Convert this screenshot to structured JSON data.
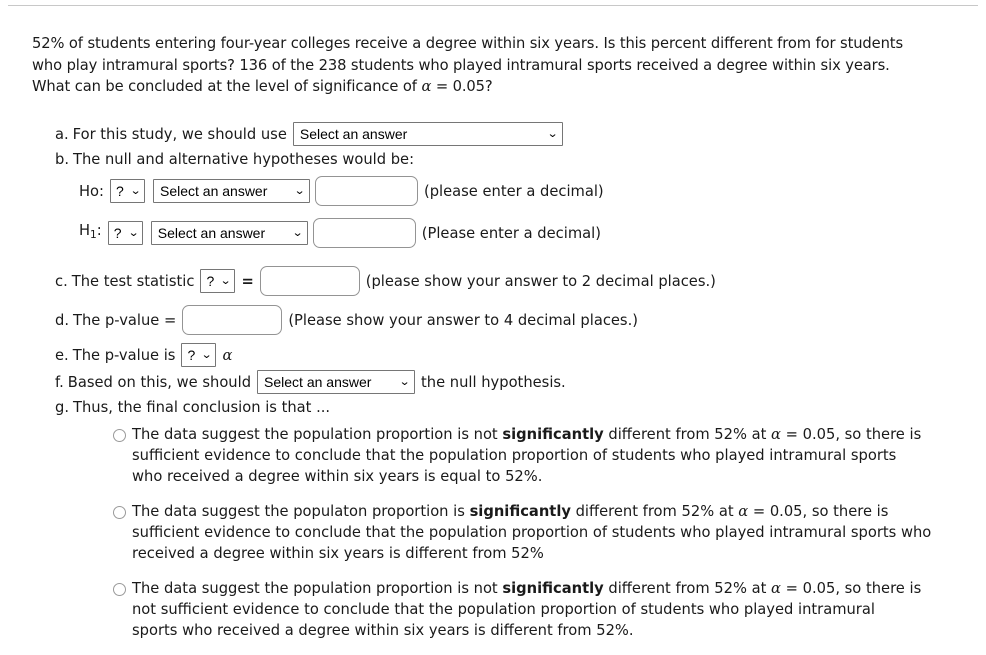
{
  "prompt": {
    "line1": "52% of students entering four-year colleges receive a degree within six years. Is this percent different from",
    "line2": "for students who play intramural sports? 136 of the 238 students who played intramural sports received a",
    "line3_pre": "degree within six years. What can be concluded at the level of significance of ",
    "line3_alpha": "α",
    "line3_post": " = 0.05?"
  },
  "parts": {
    "a": {
      "marker": "a.",
      "label": "For this study, we should use",
      "select_value": "Select an answer"
    },
    "b": {
      "marker": "b.",
      "label": "The null and alternative hypotheses would be:",
      "null_row": {
        "name": "Ho:",
        "symbol_select": "?",
        "relation_select": "Select an answer",
        "value": "",
        "hint": "(please enter a decimal)"
      },
      "alt_row": {
        "name_base": "H",
        "name_sub": "1",
        "name_colon": ":",
        "symbol_select": "?",
        "relation_select": "Select an answer",
        "value": "",
        "hint": "(Please enter a decimal)"
      }
    },
    "c": {
      "marker": "c.",
      "label": "The test statistic",
      "symbol_select": "?",
      "equals": "=",
      "value": "",
      "hint": "(please show your answer to 2 decimal places.)"
    },
    "d": {
      "marker": "d.",
      "label": "The p-value =",
      "value": "",
      "hint": "(Please show your answer to 4 decimal places.)"
    },
    "e": {
      "marker": "e.",
      "label": "The p-value is",
      "comparison_select": "?",
      "alpha": "α"
    },
    "f": {
      "marker": "f.",
      "label_pre": "Based on this, we should",
      "select_value": "Select an answer",
      "label_post": "the null hypothesis."
    },
    "g": {
      "marker": "g.",
      "label": "Thus, the final conclusion is that ..."
    }
  },
  "choices": [
    {
      "id": "choice-1",
      "seg1": "The data suggest the population proportion is not ",
      "bold1": "significantly",
      "seg2": " different from 52% at ",
      "alpha": "α",
      "seg3": " = 0.05, so there is sufficient evidence to conclude that the population proportion of students who played intramural sports who received a degree within six years is equal to 52%.",
      "selected": false
    },
    {
      "id": "choice-2",
      "seg1": "The data suggest the populaton proportion is ",
      "bold1": "significantly",
      "seg2": " different from 52% at ",
      "alpha": "α",
      "seg3": " = 0.05, so there is sufficient evidence to conclude that the population proportion of students who played intramural sports who received a degree within six years is different from 52%",
      "selected": false
    },
    {
      "id": "choice-3",
      "seg1": "The data suggest the population proportion is not ",
      "bold1": "significantly",
      "seg2": " different from 52% at ",
      "alpha": "α",
      "seg3": " = 0.05, so there is not sufficient evidence to conclude that the population proportion of students who played intramural sports who received a degree within six years is different from 52%.",
      "selected": false
    }
  ],
  "icons": {
    "caret": "⌄"
  }
}
